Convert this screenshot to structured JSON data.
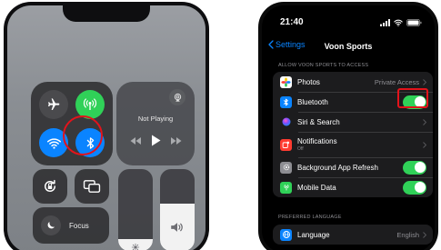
{
  "control_center": {
    "media": {
      "status_label": "Not Playing"
    },
    "focus": {
      "label": "Focus"
    },
    "brightness_level": 0.15,
    "volume_level": 0.58
  },
  "settings": {
    "status_bar": {
      "time": "21:40"
    },
    "nav": {
      "back_label": "Settings",
      "title": "Voon Sports"
    },
    "access_section": {
      "header": "ALLOW VOON SPORTS TO ACCESS",
      "rows": [
        {
          "label": "Photos",
          "value": "Private Access",
          "icon": "photos-icon"
        },
        {
          "label": "Bluetooth",
          "icon": "bluetooth-icon",
          "toggle": true
        },
        {
          "label": "Siri & Search",
          "icon": "siri-icon"
        },
        {
          "label": "Notifications",
          "sublabel": "Off",
          "icon": "notifications-icon"
        },
        {
          "label": "Background App Refresh",
          "icon": "gear-icon",
          "toggle": true
        },
        {
          "label": "Mobile Data",
          "icon": "cellular-icon",
          "toggle": true
        }
      ]
    },
    "language_section": {
      "header": "PREFERRED LANGUAGE",
      "rows": [
        {
          "label": "Language",
          "value": "English",
          "icon": "globe-icon"
        }
      ]
    }
  },
  "colors": {
    "accent_blue": "#0a84ff",
    "toggle_green": "#30d158",
    "highlight_red": "#e3131b"
  }
}
